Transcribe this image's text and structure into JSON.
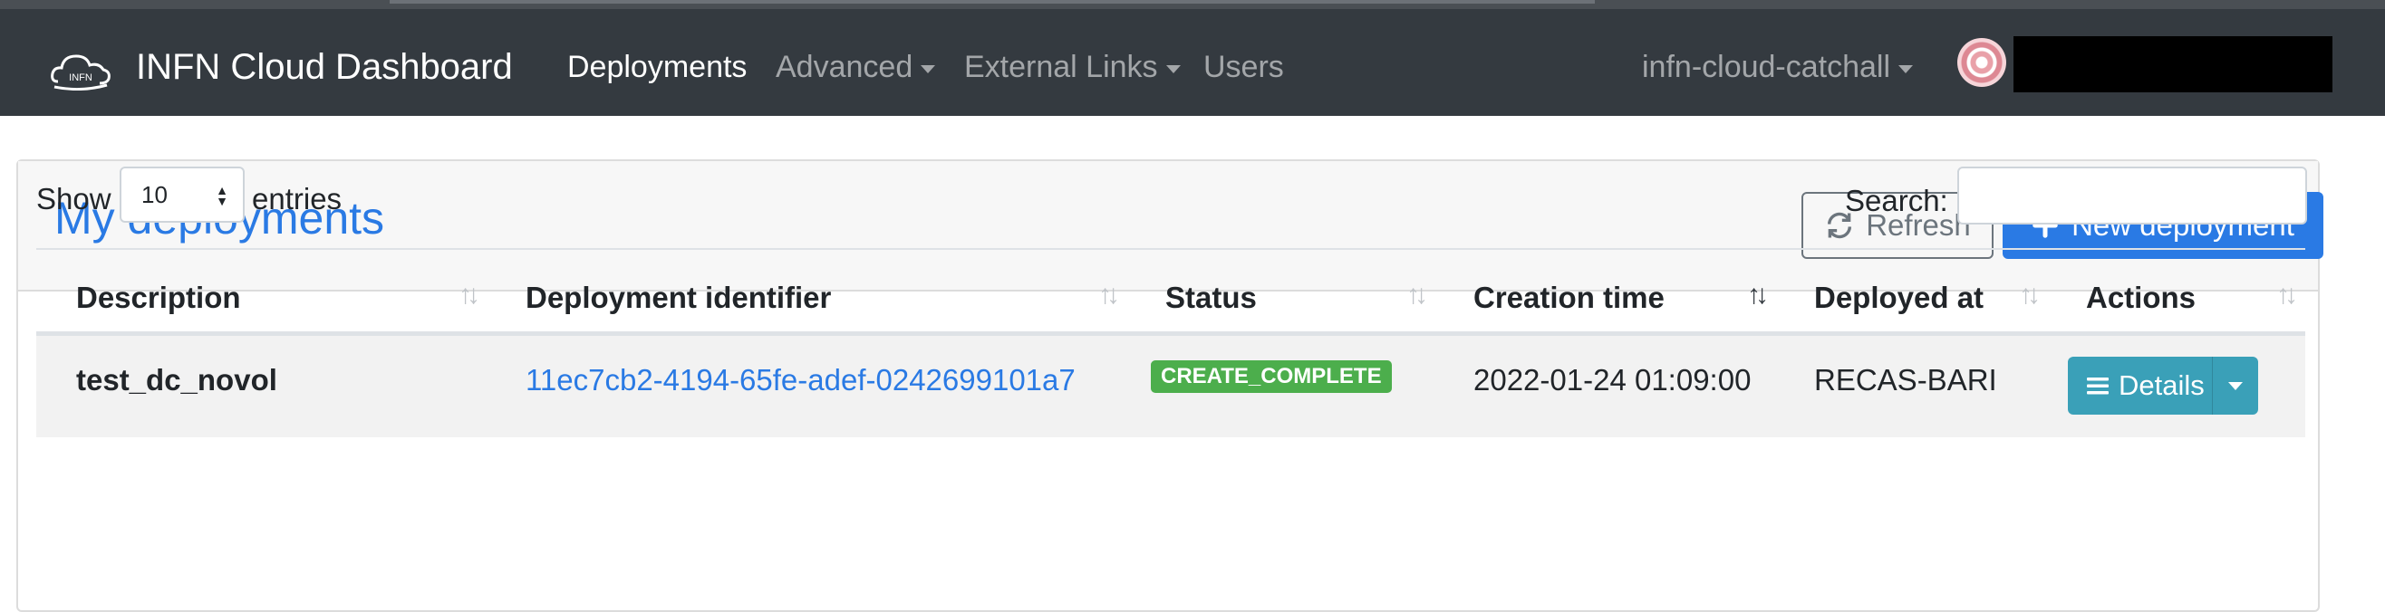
{
  "navbar": {
    "brand_logo_text": "INFN",
    "brand_title": "INFN Cloud Dashboard",
    "links": {
      "deployments": "Deployments",
      "advanced": "Advanced",
      "external_links": "External Links",
      "users": "Users"
    },
    "user_group": "infn-cloud-catchall"
  },
  "card": {
    "title": "My deployments",
    "refresh_label": "Refresh",
    "new_deployment_label": "New deployment"
  },
  "table_controls": {
    "show_label": "Show",
    "page_length": "10",
    "entries_label": "entries",
    "search_label": "Search:",
    "search_value": ""
  },
  "table": {
    "columns": [
      "Description",
      "Deployment identifier",
      "Status",
      "Creation time",
      "Deployed at",
      "Actions"
    ],
    "sorted_column": "Creation time",
    "rows": [
      {
        "description": "test_dc_novol",
        "identifier": "11ec7cb2-4194-65fe-adef-0242699101a7",
        "status": "CREATE_COMPLETE",
        "creation_time": "2022-01-24 01:09:00",
        "deployed_at": "RECAS-BARI",
        "action_label": "Details"
      }
    ]
  },
  "colors": {
    "navbar": "#343a40",
    "primary": "#2a7ae4",
    "success": "#4cae4c",
    "info": "#3aa0b8"
  }
}
